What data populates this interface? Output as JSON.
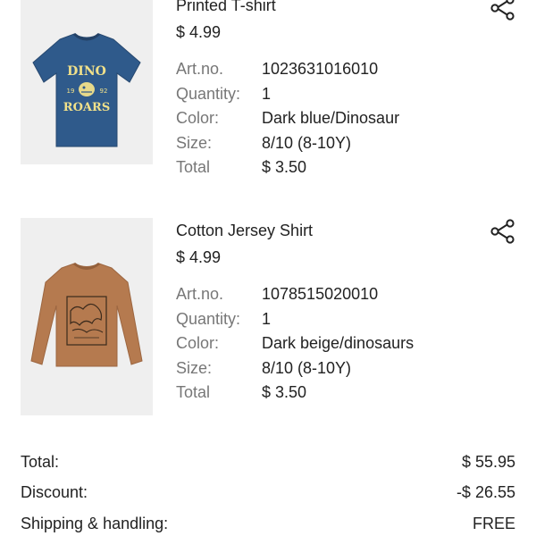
{
  "items": [
    {
      "name": "Printed T-shirt",
      "price": "$ 4.99",
      "fields": [
        {
          "label": "Art.no.",
          "value": "1023631016010"
        },
        {
          "label": "Quantity:",
          "value": "1"
        },
        {
          "label": "Color:",
          "value": "Dark blue/Dinosaur"
        },
        {
          "label": "Size:",
          "value": "8/10 (8-10Y)"
        },
        {
          "label": "Total",
          "value": "$ 3.50"
        }
      ],
      "image": {
        "shirt_color": "#2f5a8b",
        "print_color": "#f0e08a",
        "print_lines": [
          "DINO",
          "ROARS"
        ],
        "print_year_left": "19",
        "print_year_right": "92"
      }
    },
    {
      "name": "Cotton Jersey Shirt",
      "price": "$ 4.99",
      "fields": [
        {
          "label": "Art.no.",
          "value": "1078515020010"
        },
        {
          "label": "Quantity:",
          "value": "1"
        },
        {
          "label": "Color:",
          "value": "Dark beige/dinosaurs"
        },
        {
          "label": "Size:",
          "value": "8/10 (8-10Y)"
        },
        {
          "label": "Total",
          "value": "$ 3.50"
        }
      ],
      "image": {
        "shirt_color": "#b57a4f",
        "print_color": "#3a2a1c"
      }
    }
  ],
  "summary": [
    {
      "label": "Total:",
      "value": "$ 55.95"
    },
    {
      "label": "Discount:",
      "value": "-$ 26.55"
    },
    {
      "label": "Shipping & handling:",
      "value": "FREE"
    }
  ],
  "icons": {
    "share": "share-icon"
  },
  "colors": {
    "label": "#777777",
    "text": "#222222",
    "thumb_bg": "#efefef"
  }
}
